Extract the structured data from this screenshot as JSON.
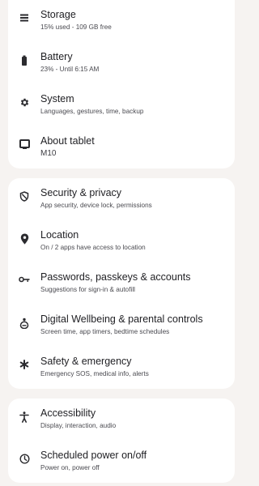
{
  "settings": {
    "groups": [
      {
        "items": [
          {
            "icon": "storage-icon",
            "title": "Storage",
            "subtitle": "15% used - 109 GB free"
          },
          {
            "icon": "battery-icon",
            "title": "Battery",
            "subtitle": "23% - Until 6:15 AM"
          },
          {
            "icon": "system-gear-icon",
            "title": "System",
            "subtitle": "Languages, gestures, time, backup"
          },
          {
            "icon": "tablet-icon",
            "title": "About tablet",
            "subtitle": "M10"
          }
        ]
      },
      {
        "items": [
          {
            "icon": "security-shield-icon",
            "title": "Security & privacy",
            "subtitle": "App security, device lock, permissions"
          },
          {
            "icon": "location-pin-icon",
            "title": "Location",
            "subtitle": "On / 2 apps have access to location"
          },
          {
            "icon": "key-icon",
            "title": "Passwords, passkeys & accounts",
            "subtitle": "Suggestions for sign-in & autofill"
          },
          {
            "icon": "digital-wellbeing-icon",
            "title": "Digital Wellbeing & parental controls",
            "subtitle": "Screen time, app timers, bedtime schedules"
          },
          {
            "icon": "emergency-asterisk-icon",
            "title": "Safety & emergency",
            "subtitle": "Emergency SOS, medical info, alerts"
          }
        ]
      },
      {
        "items": [
          {
            "icon": "accessibility-icon",
            "title": "Accessibility",
            "subtitle": "Display, interaction, audio"
          },
          {
            "icon": "power-schedule-icon",
            "title": "Scheduled power on/off",
            "subtitle": "Power on, power off"
          }
        ]
      }
    ]
  }
}
